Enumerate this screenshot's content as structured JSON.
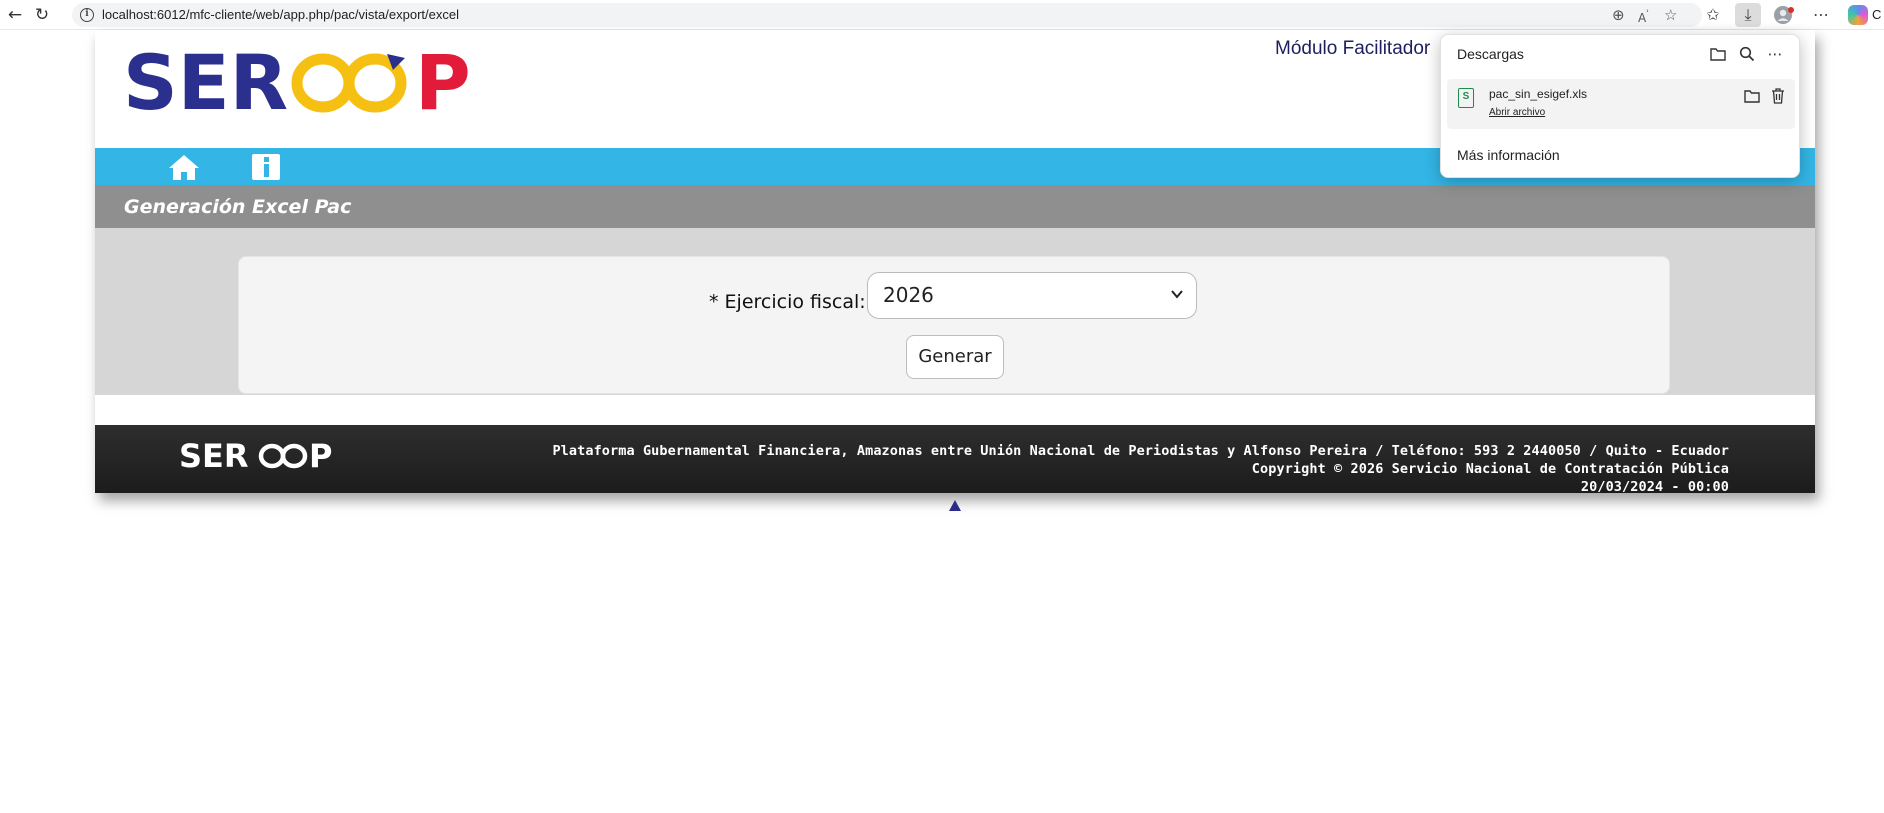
{
  "browser": {
    "url": "localhost:6012/mfc-cliente/web/app.php/pac/vista/export/excel",
    "copilot_letter": "C"
  },
  "header": {
    "logo_text": "SERCOOP",
    "module_title": "Módulo Facilitador"
  },
  "title_bar": {
    "title": "Generación Excel Pac"
  },
  "form": {
    "fiscal_year_label": "* Ejercicio fiscal:",
    "fiscal_year_value": "2026",
    "generate_label": "Generar"
  },
  "footer": {
    "logo_text": "SERCOOP",
    "address": "Plataforma Gubernamental Financiera, Amazonas entre Unión Nacional de Periodistas y Alfonso Pereira / Teléfono: 593 2 2440050 / Quito - Ecuador",
    "copyright": "Copyright © 2026 Servicio Nacional de Contratación Pública",
    "date": "20/03/2024 - 00:00"
  },
  "downloads": {
    "title": "Descargas",
    "file_name": "pac_sin_esigef.xls",
    "open_file": "Abrir archivo",
    "more_info": "Más información",
    "file_icon_letter": "S"
  },
  "colors": {
    "navbar": "#33b5e5",
    "title_bar": "#8f8f8f",
    "content_bg": "#d6d6d6",
    "footer": "#222222",
    "logo_blue": "#2b2f8e",
    "logo_yellow": "#f6c012",
    "logo_red": "#e31b3a"
  }
}
